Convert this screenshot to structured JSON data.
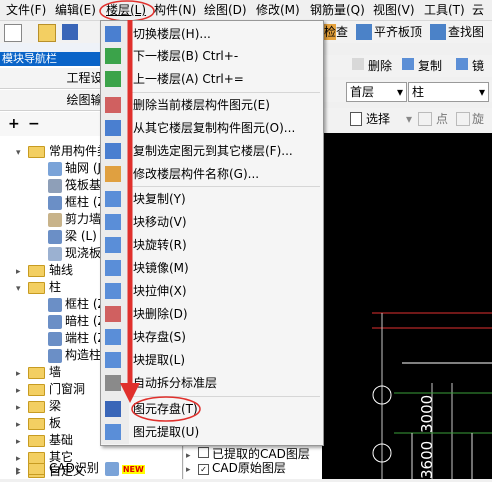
{
  "menubar": {
    "items": [
      {
        "label": "文件(F)"
      },
      {
        "label": "编辑(E)"
      },
      {
        "label": "楼层(L)"
      },
      {
        "label": "构件(N)"
      },
      {
        "label": "绘图(D)"
      },
      {
        "label": "修改(M)"
      },
      {
        "label": "钢筋量(Q)"
      },
      {
        "label": "视图(V)"
      },
      {
        "label": "工具(T)"
      },
      {
        "label": "云"
      }
    ]
  },
  "toolbar": {
    "check_label": "检查",
    "flatten_label": "平齐板顶",
    "find_label": "查找图",
    "delete_label": "删除",
    "copy_label": "复制",
    "mirror_label": "镜",
    "floor_select": "首层",
    "type_select": "柱",
    "select_label": "选择",
    "point_label": "点",
    "rotate_label": "旋"
  },
  "left_panel": {
    "nav_title": "模块导航栏",
    "buttons": [
      "工程设置",
      "绘图输入"
    ],
    "tree": [
      {
        "label": "常用构件类",
        "expanded": true
      },
      {
        "label": "轴网 (J",
        "indent": 2
      },
      {
        "label": "筏板基",
        "indent": 2
      },
      {
        "label": "框柱 (Z",
        "indent": 2
      },
      {
        "label": "剪力墙",
        "indent": 2
      },
      {
        "label": "梁 (L)",
        "indent": 2
      },
      {
        "label": "现浇板",
        "indent": 2
      },
      {
        "label": "轴线",
        "expanded": false
      },
      {
        "label": "柱",
        "expanded": true
      },
      {
        "label": "框柱 (Z",
        "indent": 2
      },
      {
        "label": "暗柱 (Z",
        "indent": 2
      },
      {
        "label": "端柱 (Z",
        "indent": 2
      },
      {
        "label": "构造柱",
        "indent": 2
      },
      {
        "label": "墙",
        "expanded": false
      },
      {
        "label": "门窗洞",
        "expanded": false
      },
      {
        "label": "梁",
        "expanded": false
      },
      {
        "label": "板",
        "expanded": false
      },
      {
        "label": "基础",
        "expanded": false
      },
      {
        "label": "其它",
        "expanded": false
      },
      {
        "label": "自定义",
        "expanded": false
      },
      {
        "label": "CAD识别",
        "expanded": false
      }
    ],
    "new_badge": "NEW"
  },
  "dropdown": {
    "items": [
      {
        "label": "切换楼层(H)...",
        "icon": "switch-floor-icon"
      },
      {
        "label": "下一楼层(B)    Ctrl+-",
        "icon": "next-floor-icon"
      },
      {
        "label": "上一楼层(A)    Ctrl+=",
        "icon": "prev-floor-icon"
      },
      {
        "label": "删除当前楼层构件图元(E)",
        "icon": "delete-floor-elements-icon"
      },
      {
        "label": "从其它楼层复制构件图元(O)...",
        "icon": "copy-from-floor-icon"
      },
      {
        "label": "复制选定图元到其它楼层(F)...",
        "icon": "copy-to-floor-icon"
      },
      {
        "label": "修改楼层构件名称(G)...",
        "icon": "rename-component-icon"
      },
      {
        "label": "块复制(Y)",
        "icon": "block-copy-icon"
      },
      {
        "label": "块移动(V)",
        "icon": "block-move-icon"
      },
      {
        "label": "块旋转(R)",
        "icon": "block-rotate-icon"
      },
      {
        "label": "块镜像(M)",
        "icon": "block-mirror-icon"
      },
      {
        "label": "块拉伸(X)",
        "icon": "block-stretch-icon"
      },
      {
        "label": "块删除(D)",
        "icon": "block-delete-icon"
      },
      {
        "label": "块存盘(S)",
        "icon": "block-save-icon"
      },
      {
        "label": "块提取(L)",
        "icon": "block-extract-icon"
      },
      {
        "label": "自动拆分标准层",
        "icon": "auto-split-icon"
      },
      {
        "label": "图元存盘(T)",
        "icon": "element-save-icon"
      },
      {
        "label": "图元提取(U)",
        "icon": "element-extract-icon"
      }
    ]
  },
  "layers": {
    "cad_extracted": "已提取的CAD图层",
    "cad_original": "CAD原始图层"
  },
  "canvas": {
    "dimension_text": "3600",
    "dimension_text2": "3000"
  },
  "colors": {
    "accent_blue": "#0a64c8",
    "highlight_red": "#e0302c",
    "canvas_bg": "#000000"
  }
}
